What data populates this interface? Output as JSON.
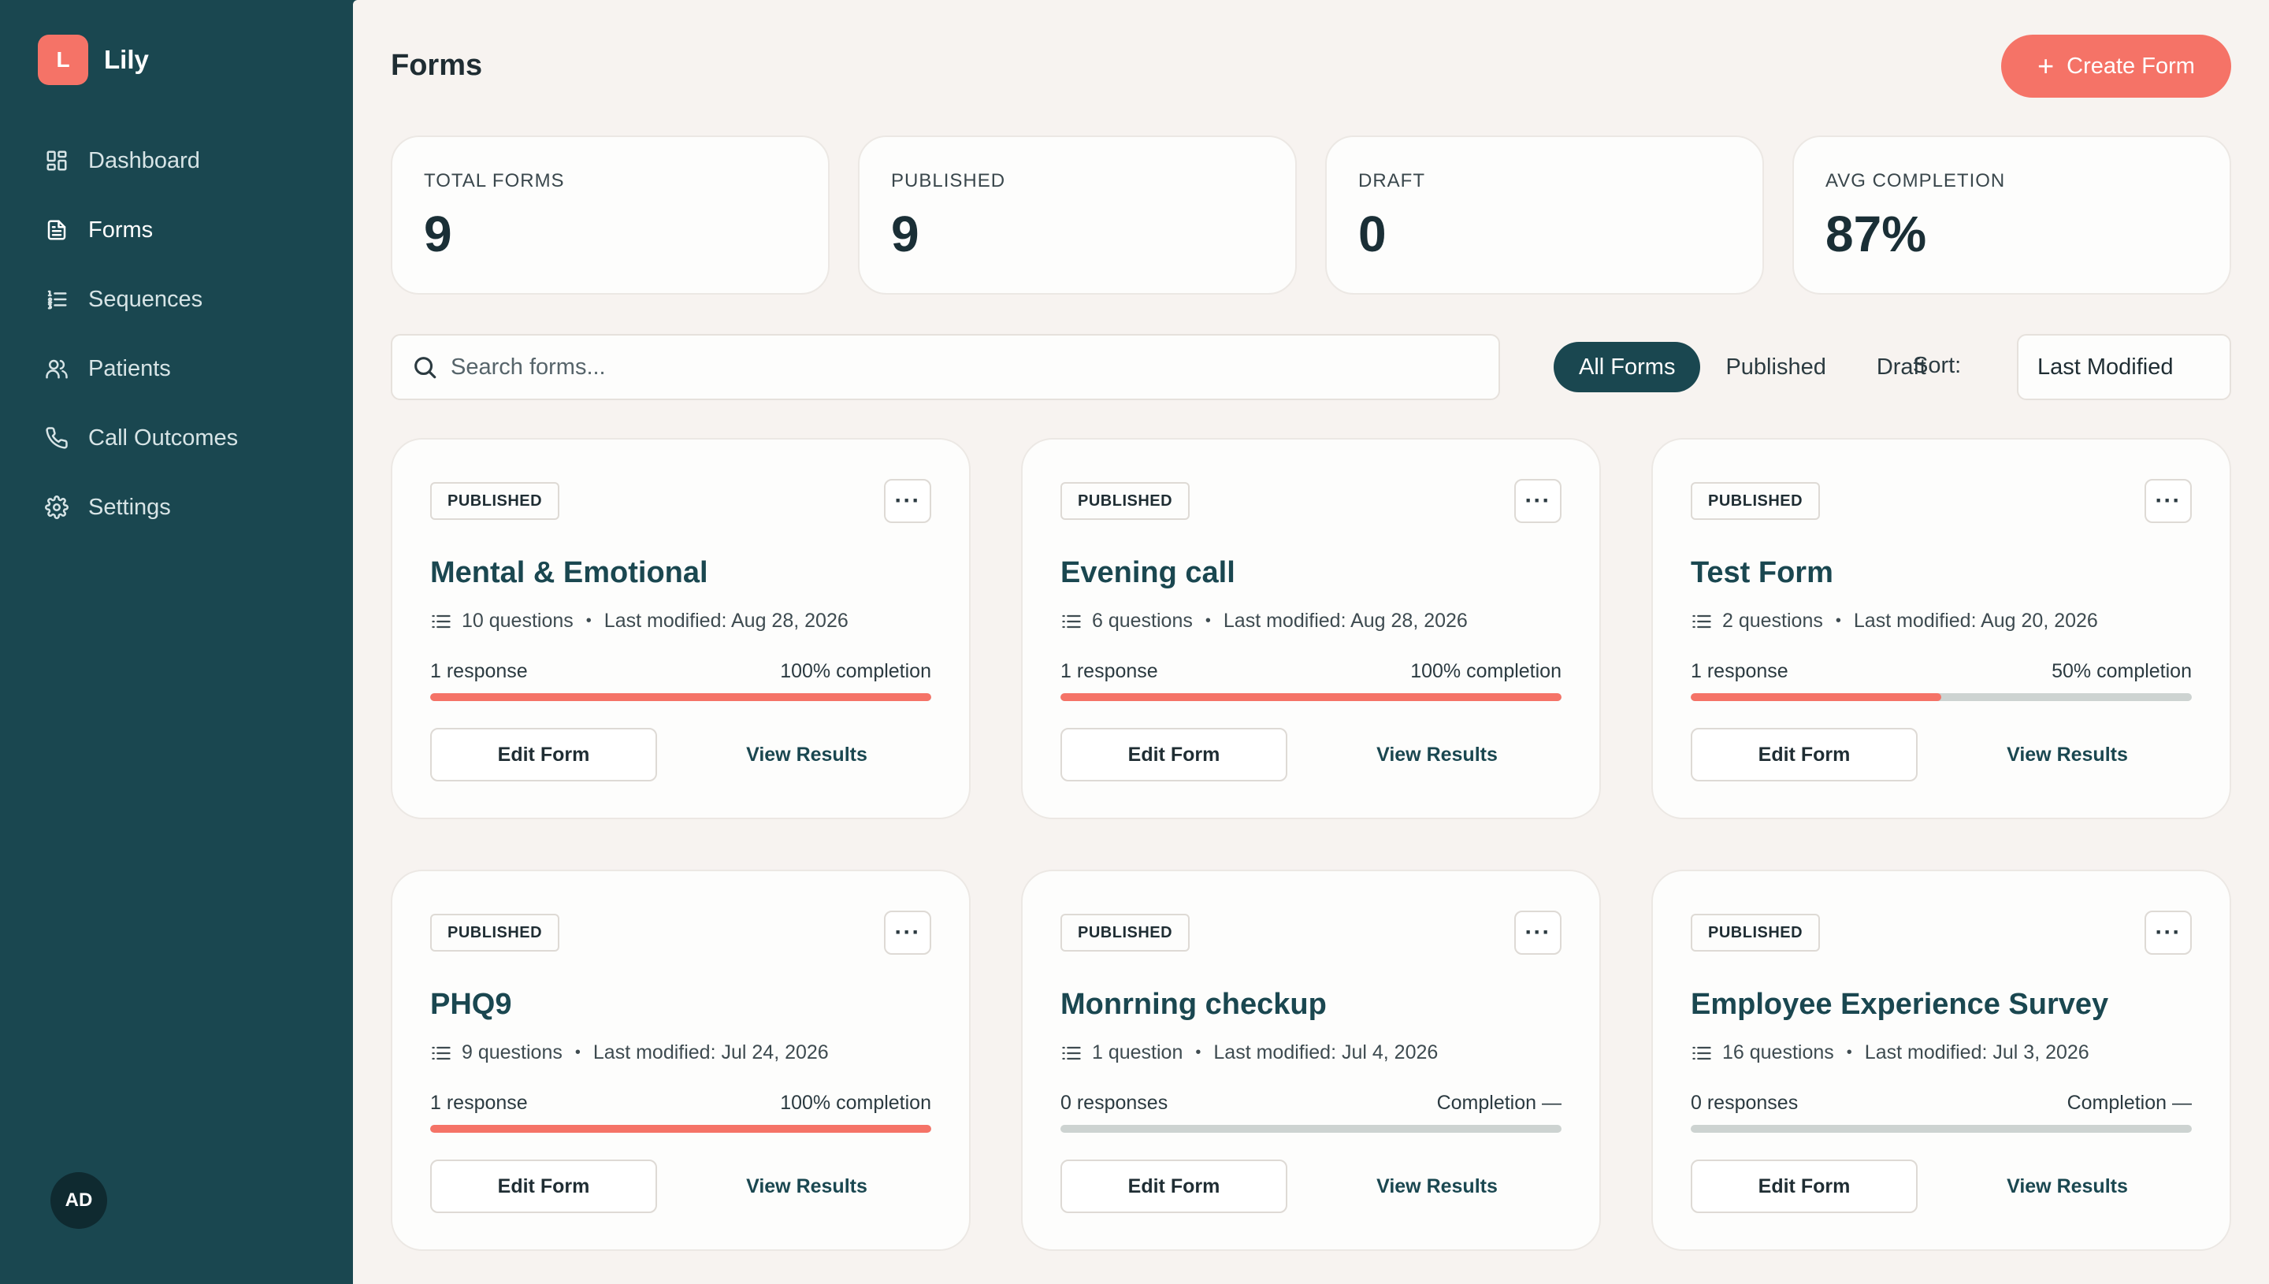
{
  "brand": {
    "logo_letter": "L",
    "name": "Lily"
  },
  "sidebar": {
    "items": [
      {
        "label": "Dashboard",
        "icon": "dashboard-icon",
        "active": false
      },
      {
        "label": "Forms",
        "icon": "document-icon",
        "active": true
      },
      {
        "label": "Sequences",
        "icon": "list-numbered-icon",
        "active": false
      },
      {
        "label": "Patients",
        "icon": "users-icon",
        "active": false
      },
      {
        "label": "Call Outcomes",
        "icon": "phone-icon",
        "active": false
      },
      {
        "label": "Settings",
        "icon": "gear-icon",
        "active": false
      }
    ],
    "avatar_initials": "AD"
  },
  "header": {
    "title": "Forms",
    "create_label": "Create Form"
  },
  "stats": [
    {
      "label": "TOTAL FORMS",
      "value": "9"
    },
    {
      "label": "PUBLISHED",
      "value": "9"
    },
    {
      "label": "DRAFT",
      "value": "0"
    },
    {
      "label": "AVG COMPLETION",
      "value": "87%"
    }
  ],
  "toolbar": {
    "search_placeholder": "Search forms...",
    "filters": [
      "All Forms",
      "Published",
      "Draft"
    ],
    "active_filter": "All Forms",
    "sort_label": "Sort:",
    "sort_value": "Last Modified"
  },
  "colors": {
    "accent": "#f57367",
    "primary": "#1a4750",
    "background": "#f7f3f0"
  },
  "forms": [
    {
      "status": "PUBLISHED",
      "title": "Mental & Emotional",
      "questions": "10 questions",
      "modified": "Last modified: Aug 28, 2026",
      "responses": "1 response",
      "completion_text": "100% completion",
      "completion": 1.0,
      "edit_label": "Edit Form",
      "view_label": "View Results"
    },
    {
      "status": "PUBLISHED",
      "title": "Evening call",
      "questions": "6 questions",
      "modified": "Last modified: Aug 28, 2026",
      "responses": "1 response",
      "completion_text": "100% completion",
      "completion": 1.0,
      "edit_label": "Edit Form",
      "view_label": "View Results"
    },
    {
      "status": "PUBLISHED",
      "title": "Test Form",
      "questions": "2 questions",
      "modified": "Last modified: Aug 20, 2026",
      "responses": "1 response",
      "completion_text": "50% completion",
      "completion": 0.5,
      "edit_label": "Edit Form",
      "view_label": "View Results"
    },
    {
      "status": "PUBLISHED",
      "title": "PHQ9",
      "questions": "9 questions",
      "modified": "Last modified: Jul 24, 2026",
      "responses": "1 response",
      "completion_text": "100% completion",
      "completion": 1.0,
      "edit_label": "Edit Form",
      "view_label": "View Results"
    },
    {
      "status": "PUBLISHED",
      "title": "Monrning checkup",
      "questions": "1 question",
      "modified": "Last modified: Jul 4, 2026",
      "responses": "0 responses",
      "completion_text": "Completion —",
      "completion": 0,
      "edit_label": "Edit Form",
      "view_label": "View Results"
    },
    {
      "status": "PUBLISHED",
      "title": "Employee Experience Survey",
      "questions": "16 questions",
      "modified": "Last modified: Jul 3, 2026",
      "responses": "0 responses",
      "completion_text": "Completion —",
      "completion": 0,
      "edit_label": "Edit Form",
      "view_label": "View Results"
    }
  ]
}
